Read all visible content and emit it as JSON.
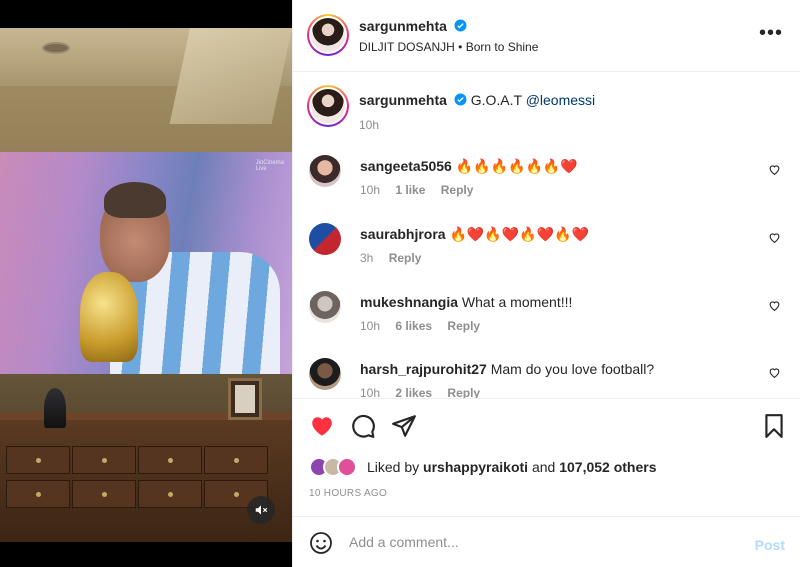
{
  "post": {
    "author": "sargunmehta",
    "audio_artist": "DILJIT DOSANJH",
    "audio_song": "Born to Shine",
    "caption_text": "G.O.A.T",
    "caption_mention": "@leomessi",
    "caption_age": "10h",
    "video_overlay_text": "JioCinema\nLive"
  },
  "comments": [
    {
      "user": "sangeeta5056",
      "text": "🔥🔥🔥🔥🔥🔥❤️",
      "age": "10h",
      "likes": "1 like",
      "reply": "Reply"
    },
    {
      "user": "saurabhjrora",
      "text": "🔥❤️🔥❤️🔥❤️🔥❤️",
      "age": "3h",
      "likes": "",
      "reply": "Reply"
    },
    {
      "user": "mukeshnangia",
      "text": "What a moment!!!",
      "age": "10h",
      "likes": "6 likes",
      "reply": "Reply"
    },
    {
      "user": "harsh_rajpurohit27",
      "text": "Mam do you love football?",
      "age": "10h",
      "likes": "2 likes",
      "reply": "Reply"
    }
  ],
  "likes": {
    "prefix": "Liked by",
    "user": "urshappyraikoti",
    "connector": "and",
    "count": "107,052 others"
  },
  "posted_time": "10 HOURS AGO",
  "add_comment": {
    "placeholder": "Add a comment...",
    "post_label": "Post"
  },
  "colors": {
    "like_red": "#ff3040",
    "verified_blue": "#0095f6",
    "post_button_disabled": "#b3dbff",
    "meta_grey": "#8e8e8e"
  },
  "icons": {
    "more": "more-options-icon",
    "like": "heart-filled-icon",
    "comment": "comment-bubble-icon",
    "share": "paper-plane-icon",
    "save": "bookmark-icon",
    "emoji": "emoji-smile-icon",
    "mute": "speaker-muted-icon"
  }
}
